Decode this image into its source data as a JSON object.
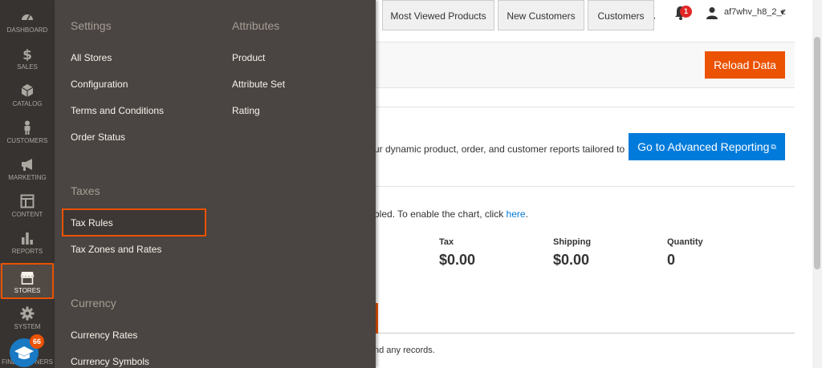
{
  "header": {
    "notifications_count": "1",
    "user_name": "af7whv_h8_2_z",
    "caret": "▾"
  },
  "dashboard": {
    "reload_button": "Reload Data",
    "advanced_text": "ur dynamic product, order, and customer reports tailored to",
    "advanced_button": "Go to Advanced Reporting",
    "chart_message": "bled. To enable the chart, click ",
    "chart_link": "here",
    "chart_message_end": ".",
    "stats": [
      {
        "label": "Tax",
        "value": "$0.00"
      },
      {
        "label": "Shipping",
        "value": "$0.00"
      },
      {
        "label": "Quantity",
        "value": "0"
      }
    ],
    "tabs": [
      "Most Viewed Products",
      "New Customers",
      "Customers"
    ],
    "no_records": "nd any records."
  },
  "sidenav": {
    "items": [
      {
        "label": "DASHBOARD",
        "icon": "dashboard-icon"
      },
      {
        "label": "SALES",
        "icon": "dollar-icon"
      },
      {
        "label": "CATALOG",
        "icon": "box-icon"
      },
      {
        "label": "CUSTOMERS",
        "icon": "person-icon"
      },
      {
        "label": "MARKETING",
        "icon": "megaphone-icon"
      },
      {
        "label": "CONTENT",
        "icon": "layout-icon"
      },
      {
        "label": "REPORTS",
        "icon": "bar-chart-icon"
      },
      {
        "label": "STORES",
        "icon": "store-icon"
      },
      {
        "label": "SYSTEM",
        "icon": "gear-icon"
      }
    ],
    "badge_count": "66",
    "bottom_label": "FIND PARTNERS"
  },
  "flyout": {
    "settings_heading": "Settings",
    "settings_links": [
      "All Stores",
      "Configuration",
      "Terms and Conditions",
      "Order Status"
    ],
    "taxes_heading": "Taxes",
    "taxes_links": [
      "Tax Rules",
      "Tax Zones and Rates"
    ],
    "currency_heading": "Currency",
    "currency_links": [
      "Currency Rates",
      "Currency Symbols"
    ],
    "attributes_heading": "Attributes",
    "attributes_links": [
      "Product",
      "Attribute Set",
      "Rating"
    ]
  },
  "colors": {
    "accent": "#eb5202",
    "link_blue": "#007bdb",
    "nav_bg": "#373330",
    "flyout_bg": "#4a4542"
  }
}
